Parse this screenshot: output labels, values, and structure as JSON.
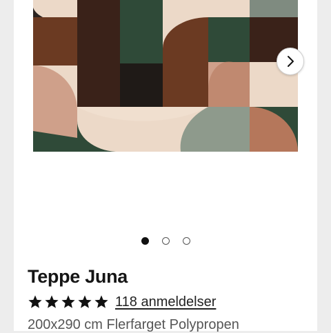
{
  "product": {
    "title": "Teppe Juna",
    "rating_stars": 5,
    "reviews_label": "118 anmeldelser",
    "description": "200x290 cm Flerfarget Polypropen"
  },
  "gallery": {
    "image_count": 3,
    "active_index": 0,
    "next_icon": "chevron-right-icon"
  },
  "colors": {
    "rug_dark_green": "#2f4a38",
    "rug_brown": "#6b3a22",
    "rug_dark_brown": "#3a2219",
    "rug_beige": "#ecd9c8",
    "rug_pink": "#cfa08a",
    "rug_grey_green": "#8e9a8c",
    "rug_terracotta": "#b5775b",
    "star": "#111111"
  }
}
